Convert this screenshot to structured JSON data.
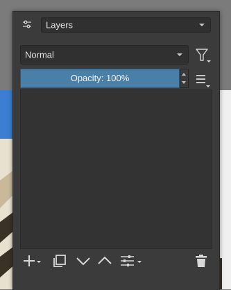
{
  "docker": {
    "title_select": "Layers",
    "blend_mode": "Normal",
    "opacity_label": "Opacity:",
    "opacity_value": "100%"
  },
  "icons": {
    "docker": "sliders-icon",
    "filter": "filter-icon",
    "menu": "hamburger-menu-icon",
    "add": "plus-icon",
    "duplicate": "duplicate-icon",
    "move_down": "chevron-down-icon",
    "move_up": "chevron-up-icon",
    "properties": "layer-properties-icon",
    "delete": "trash-icon"
  },
  "colors": {
    "panel_bg": "#3b3b3b",
    "opacity_fill": "#4a7fa8",
    "list_bg": "#333333"
  }
}
